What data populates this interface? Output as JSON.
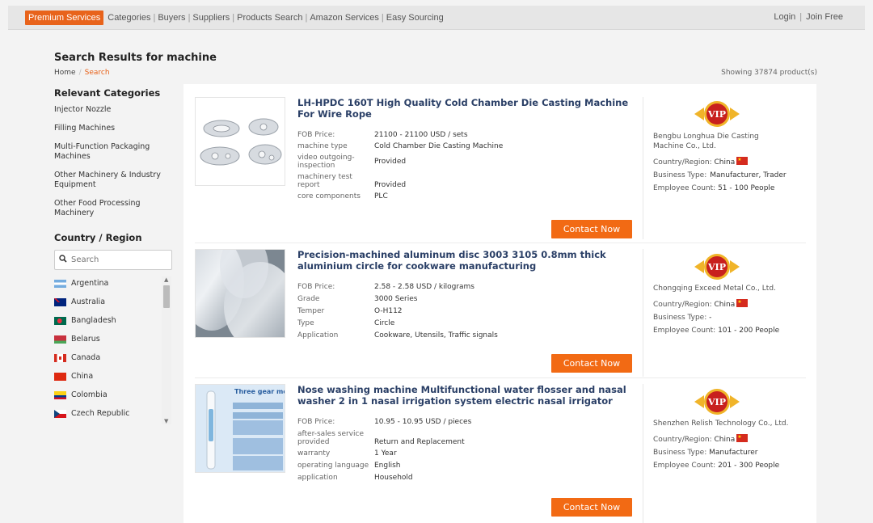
{
  "topbar": {
    "nav": [
      "Premium Services",
      "Categories",
      "Buyers",
      "Suppliers",
      "Products Search",
      "Amazon Services",
      "Easy Sourcing"
    ],
    "login": "Login",
    "join": "Join Free"
  },
  "page": {
    "title": "Search Results for machine",
    "breadcrumb_home": "Home",
    "breadcrumb_current": "Search",
    "showing": "Showing 37874 product(s)"
  },
  "sidebar": {
    "categories_title": "Relevant Categories",
    "categories": [
      "Injector Nozzle",
      "Filling Machines",
      "Multi-Function Packaging Machines",
      "Other Machinery & Industry Equipment",
      "Other Food Processing Machinery"
    ],
    "country_title": "Country / Region",
    "search_placeholder": "Search",
    "countries": [
      "Argentina",
      "Australia",
      "Bangladesh",
      "Belarus",
      "Canada",
      "China",
      "Colombia",
      "Czech Republic"
    ]
  },
  "products": [
    {
      "title": "LH-HPDC 160T High Quality Cold Chamber Die Casting Machine For Wire Rope",
      "attrs": [
        {
          "k": "FOB Price:",
          "v": "21100 - 21100 USD / sets"
        },
        {
          "k": "machine type",
          "v": "Cold Chamber Die Casting Machine"
        },
        {
          "k": "video outgoing-inspection",
          "v": "Provided"
        },
        {
          "k": "machinery test report",
          "v": "Provided"
        },
        {
          "k": "core components",
          "v": "PLC"
        }
      ],
      "button": "Contact Now",
      "supplier": {
        "badge": "VIP",
        "name": "Bengbu Longhua Die Casting Machine Co., Ltd.",
        "country_label": "Country/Region:",
        "country": "China",
        "business_label": "Business Type:",
        "business": "Manufacturer, Trader",
        "employee_label": "Employee Count:",
        "employee": "51 - 100 People"
      }
    },
    {
      "title": "Precision-machined aluminum disc 3003 3105 0.8mm thick aluminium circle for cookware manufacturing",
      "attrs": [
        {
          "k": "FOB Price:",
          "v": "2.58 - 2.58 USD / kilograms"
        },
        {
          "k": "Grade",
          "v": "3000 Series"
        },
        {
          "k": "Temper",
          "v": "O-H112"
        },
        {
          "k": "Type",
          "v": "Circle"
        },
        {
          "k": "Application",
          "v": "Cookware, Utensils, Traffic signals"
        }
      ],
      "button": "Contact Now",
      "supplier": {
        "badge": "VIP",
        "name": "Chongqing Exceed Metal Co., Ltd.",
        "country_label": "Country/Region:",
        "country": "China",
        "business_label": "Business Type:",
        "business": "-",
        "employee_label": "Employee Count:",
        "employee": "101 - 200 People"
      }
    },
    {
      "title": "Nose washing machine Multifunctional water flosser and nasal washer 2 in 1 nasal irrigation system electric nasal irrigator",
      "attrs": [
        {
          "k": "FOB Price:",
          "v": "10.95 - 10.95 USD / pieces"
        },
        {
          "k": "after-sales service provided",
          "v": "Return and Replacement"
        },
        {
          "k": "warranty",
          "v": "1 Year"
        },
        {
          "k": "operating language",
          "v": "English"
        },
        {
          "k": "application",
          "v": "Household"
        }
      ],
      "image_text": "Three gear mode",
      "button": "Contact Now",
      "supplier": {
        "badge": "VIP",
        "name": "Shenzhen Relish Technology Co., Ltd.",
        "country_label": "Country/Region:",
        "country": "China",
        "business_label": "Business Type:",
        "business": "Manufacturer",
        "employee_label": "Employee Count:",
        "employee": "201 - 300 People"
      }
    }
  ],
  "colors": {
    "accent": "#f26a14",
    "title_blue": "#2a3f66",
    "vip_red": "#c8201e",
    "vip_gold": "#f0b429"
  }
}
